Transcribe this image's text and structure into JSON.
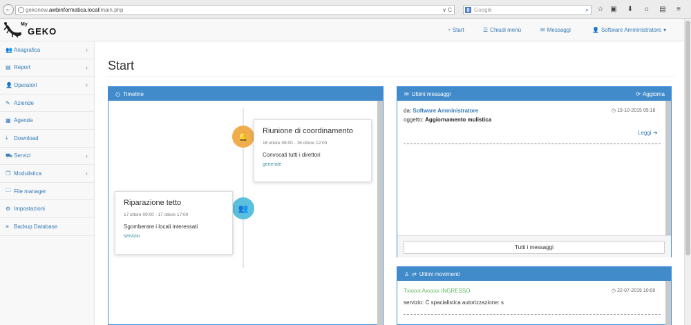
{
  "browser": {
    "back_glyph": "←",
    "url_prefix": "gekonew.",
    "url_domain": "awbinformatica.local",
    "url_path": "/main.php",
    "url_arrows": "∨ C",
    "search_placeholder": "Google",
    "search_engine_letter": "g"
  },
  "app": {
    "logo_my": "My",
    "logo_geko": "GEKO"
  },
  "topnav": {
    "start": "Start",
    "close_menu": "Chiudi menù",
    "messages": "Messaggi",
    "user": "Software Amministratore"
  },
  "sidebar": {
    "items": [
      {
        "label": "Anagrafica",
        "icon": "users-icon",
        "glyph": "👥",
        "chevron": "‹"
      },
      {
        "label": "Report",
        "icon": "chart-icon",
        "glyph": "▤",
        "chevron": "‹"
      },
      {
        "label": "Operatori",
        "icon": "user-icon",
        "glyph": "👤",
        "chevron": "‹"
      },
      {
        "label": "Aziende",
        "icon": "wrench-icon",
        "glyph": "✎",
        "chevron": ""
      },
      {
        "label": "Agenda",
        "icon": "calendar-icon",
        "glyph": "▦",
        "chevron": ""
      },
      {
        "label": "Download",
        "icon": "download-icon",
        "glyph": "⤓",
        "chevron": ""
      },
      {
        "label": "Servizi",
        "icon": "truck-icon",
        "glyph": "⛟",
        "chevron": "‹"
      },
      {
        "label": "Modulistica",
        "icon": "copy-icon",
        "glyph": "❐",
        "chevron": "‹"
      },
      {
        "label": "File manager",
        "icon": "folder-icon",
        "glyph": "🗀",
        "chevron": ""
      },
      {
        "label": "Impostazioni",
        "icon": "cogs-icon",
        "glyph": "⚙",
        "chevron": ""
      },
      {
        "label": "Backup Database",
        "icon": "bars-icon",
        "glyph": "≡",
        "chevron": ""
      }
    ]
  },
  "main": {
    "title": "Start"
  },
  "timeline": {
    "heading": "Timeline",
    "events": [
      {
        "title": "Riunione di coordinamento",
        "date": "16 ottore 08:00 - 16 ottore 12:00",
        "body": "Convocati tutti i direttori",
        "category": "generale",
        "badge_color": "#f0ad4e"
      },
      {
        "title": "Riparazione tetto",
        "date": "17 ottore 09:00 - 17 ottore 17:00",
        "body": "Sgomberare i locali interessati",
        "category": "servizio",
        "badge_color": "#5bc0de"
      }
    ]
  },
  "messages": {
    "heading": "Ultimi messaggi",
    "refresh": "Aggiorna",
    "item": {
      "from_label": "da:",
      "from": "Software Amministratore",
      "date": "15-10-2015 05:18",
      "subject_label": "oggetto:",
      "subject": "Aggiornamento mulistica",
      "read": "Leggi"
    },
    "all_button": "Tutti i messaggi"
  },
  "movements": {
    "heading": "Ultimi movimenti",
    "item": {
      "name": "Txxxxx Axxxxx INGRESSO",
      "date": "22-07-2015 10:00",
      "service_label": "servizio:",
      "service": "C spacialistica autorizzazione: s"
    }
  },
  "colors": {
    "primary": "#428bca",
    "link": "#337ab7",
    "success": "#5cb85c",
    "warning": "#f0ad4e",
    "info": "#5bc0de"
  }
}
